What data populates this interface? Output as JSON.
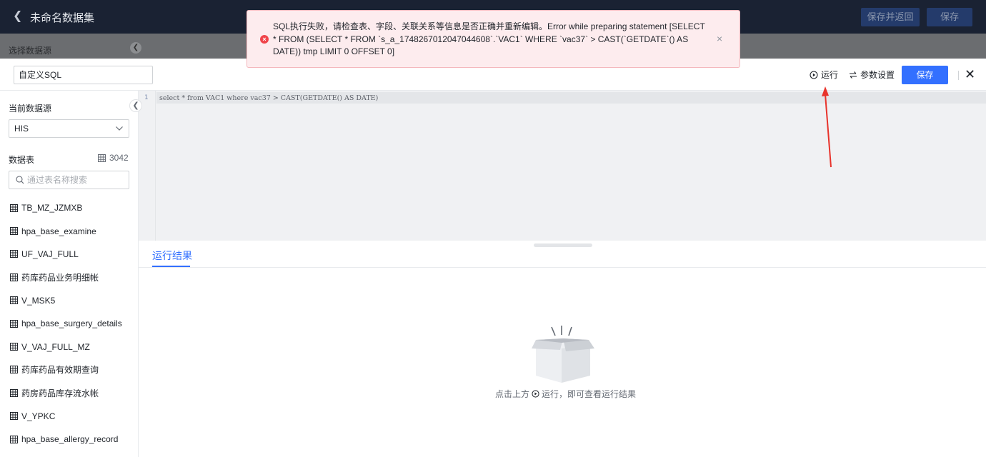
{
  "header": {
    "back_icon": "chevron-left-icon",
    "title": "未命名数据集",
    "save_return_label": "保存并返回",
    "save_label": "保存"
  },
  "source_strip": {
    "label": "选择数据源"
  },
  "toast": {
    "type": "error",
    "message": "SQL执行失败，请检查表、字段、关联关系等信息是否正确并重新编辑。Error while preparing statement [SELECT * FROM (SELECT * FROM `s_a_1748267012047044608`.`VAC1` WHERE `vac37` > CAST(`GETDATE`() AS DATE)) tmp LIMIT 0 OFFSET 0]",
    "error_glyph": "×",
    "close_glyph": "×"
  },
  "sql_toolbar": {
    "name_value": "自定义SQL",
    "run_label": "运行",
    "params_label": "参数设置",
    "save_label": "保存",
    "close_glyph": "✕"
  },
  "left_panel": {
    "current_source_label": "当前数据源",
    "current_source_value": "HIS",
    "tables_label": "数据表",
    "tables_count": "3042",
    "search_placeholder": "通过表名称搜索",
    "tables": [
      "TB_MZ_JZMXB",
      "hpa_base_examine",
      "UF_VAJ_FULL",
      "药库药品业务明细帐",
      "V_MSK5",
      "hpa_base_surgery_details",
      "V_VAJ_FULL_MZ",
      "药库药品有效期查询",
      "药房药品库存流水帐",
      "V_YPKC",
      "hpa_base_allergy_record"
    ]
  },
  "editor": {
    "line_number": "1",
    "code": "select * from VAC1 where vac37 > CAST(GETDATE() AS DATE)"
  },
  "results": {
    "tab_label": "运行结果",
    "hint_before": "点击上方",
    "hint_after": "运行，即可查看运行结果"
  },
  "colors": {
    "primary": "#3370ff",
    "error": "#f0454b",
    "header_bg": "#1a2233",
    "annotation_arrow": "#e8332b"
  }
}
